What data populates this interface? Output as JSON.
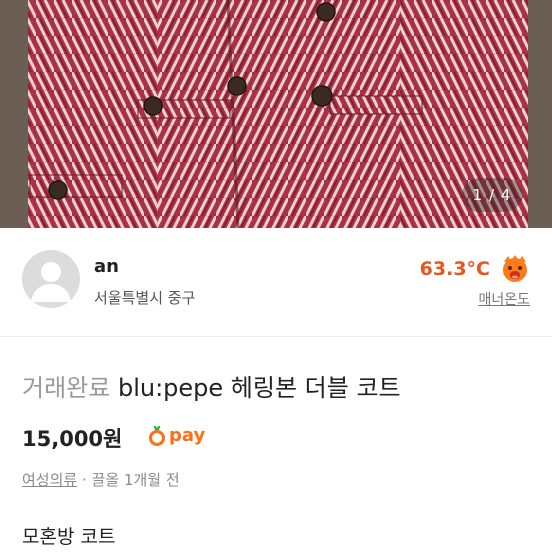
{
  "photo": {
    "counter": "1 / 4",
    "main_color": "#a83245",
    "stripe_color": "#e9c9c9"
  },
  "seller": {
    "name": "an",
    "location": "서울특별시 중구",
    "temperature": "63.3°C",
    "manner_label": "매너온도",
    "temperature_color": "#e8551f"
  },
  "product": {
    "status": "거래완료",
    "title": "blu:pepe 헤링본 더블 코트",
    "price": "15,000원",
    "pay_label": "pay",
    "category": "여성의류",
    "separator": "·",
    "bump_time": "끌올 1개월 전",
    "description": "모혼방 코트"
  }
}
